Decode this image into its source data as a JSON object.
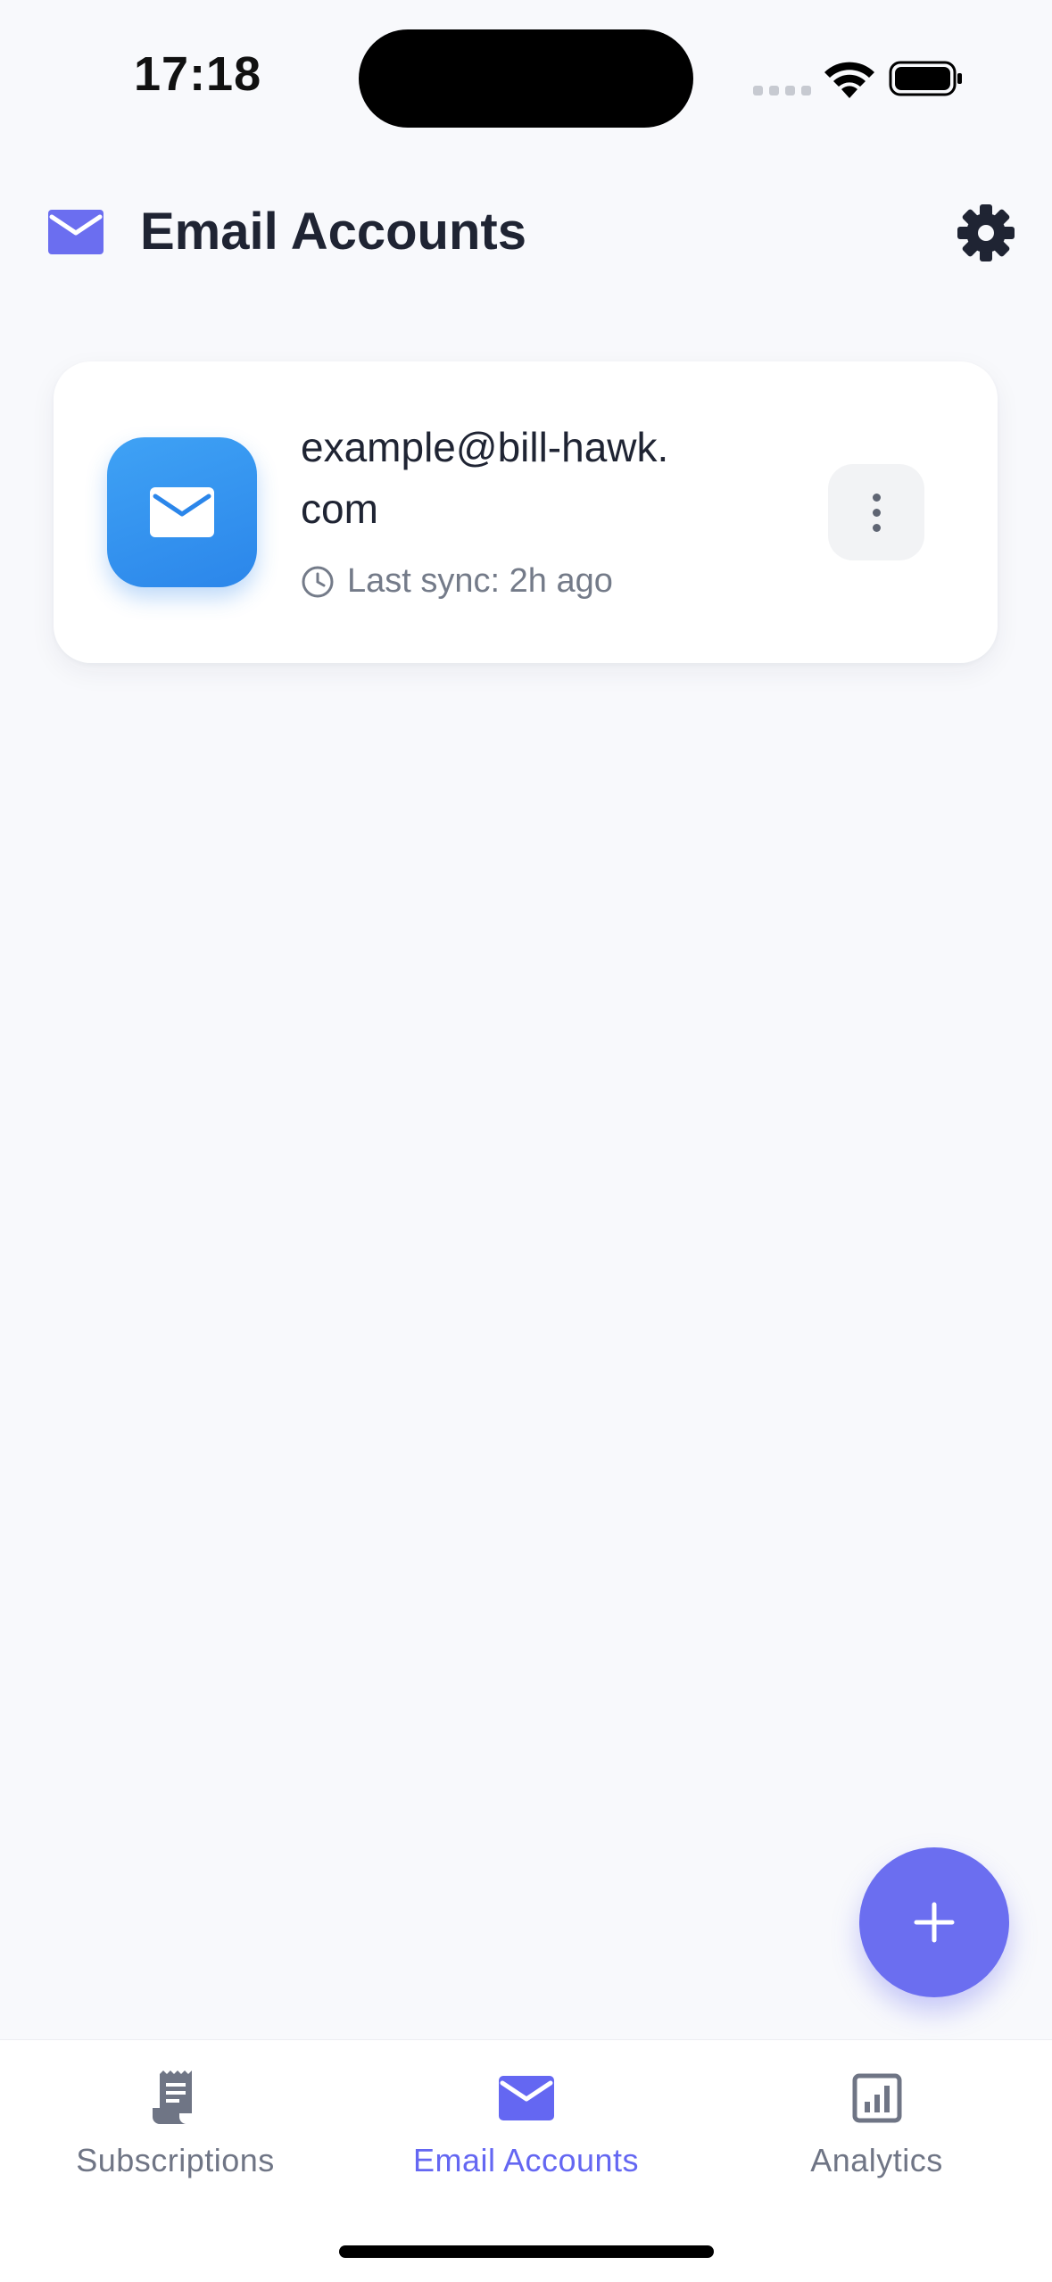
{
  "status_bar": {
    "time": "17:18"
  },
  "header": {
    "title": "Email Accounts",
    "icon": "mail-icon",
    "settings_icon": "gear-icon"
  },
  "accounts": [
    {
      "email": "example@bill-hawk.com",
      "sync_label": "Last sync: 2h ago",
      "icon": "mail-icon",
      "menu_icon": "more-vertical-icon"
    }
  ],
  "fab": {
    "icon": "plus-icon"
  },
  "tabs": [
    {
      "label": "Subscriptions",
      "icon": "receipt-icon",
      "active": false
    },
    {
      "label": "Email Accounts",
      "icon": "mail-icon",
      "active": true
    },
    {
      "label": "Analytics",
      "icon": "chart-icon",
      "active": false
    }
  ],
  "colors": {
    "accent": "#6467f2",
    "avatar_blue": "#2b86ea",
    "background": "#f8f9fc"
  }
}
